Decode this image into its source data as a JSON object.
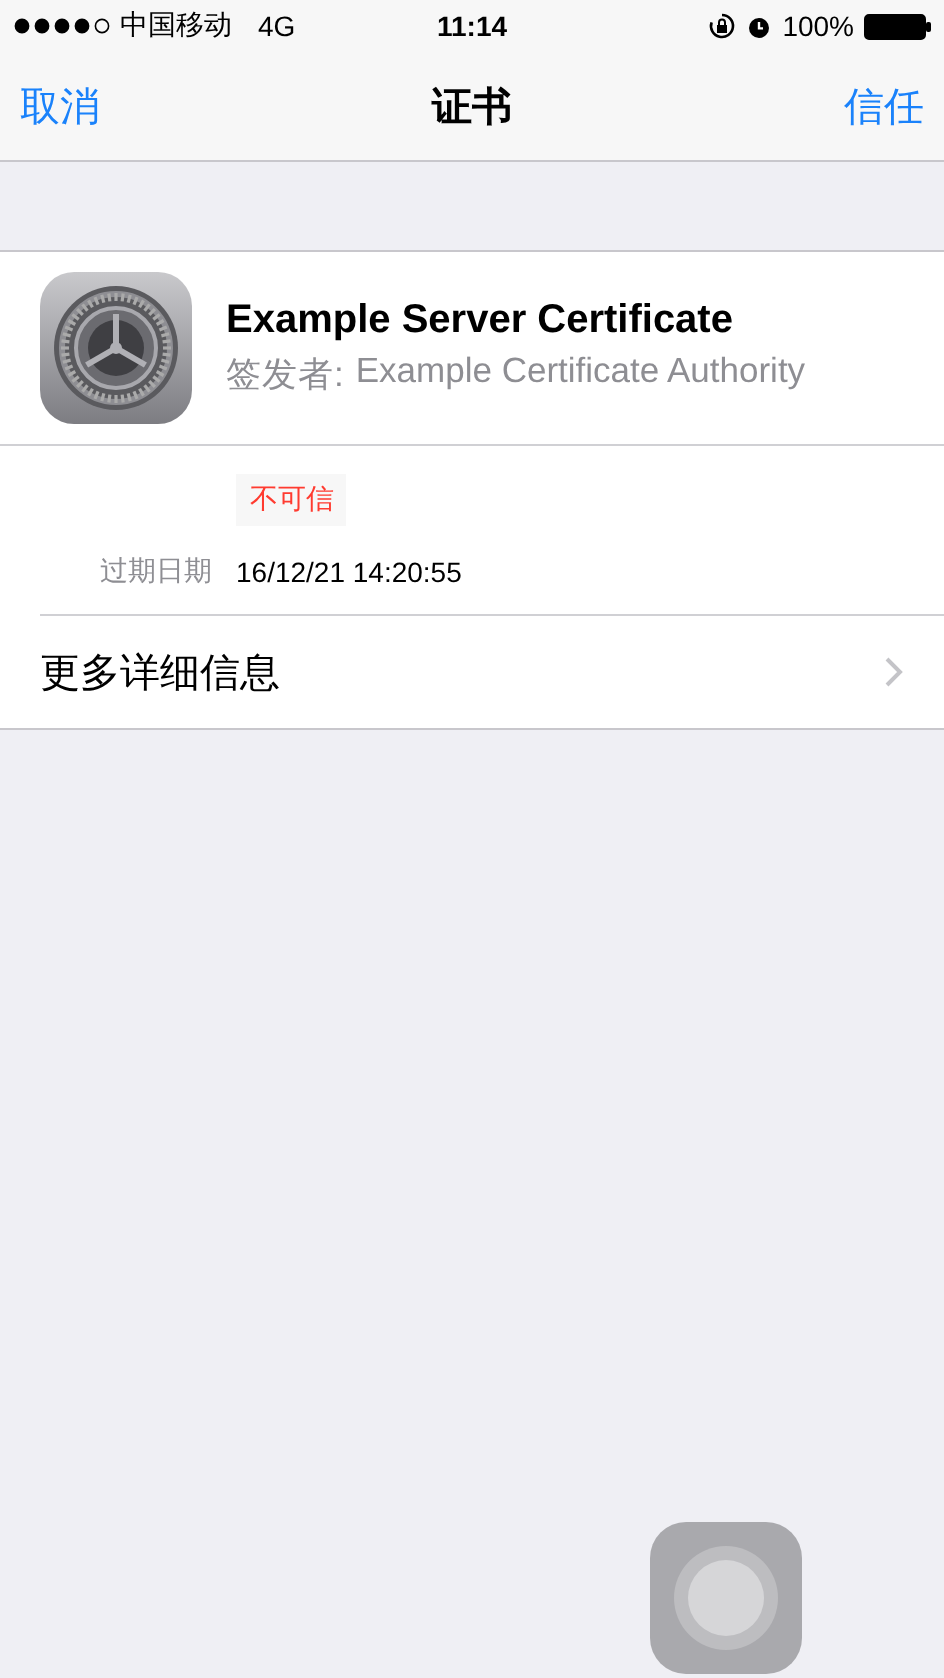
{
  "status_bar": {
    "carrier": "中国移动",
    "network": "4G",
    "time": "11:14",
    "battery": "100%"
  },
  "nav": {
    "cancel": "取消",
    "title": "证书",
    "trust": "信任"
  },
  "certificate": {
    "name": "Example Server Certificate",
    "issuer_label": "签发者:",
    "issuer": "Example Certificate Authority",
    "status": "不可信",
    "trusted": false,
    "expiry_label": "过期日期",
    "expiry": "16/12/21 14:20:55"
  },
  "more": {
    "label": "更多详细信息"
  }
}
